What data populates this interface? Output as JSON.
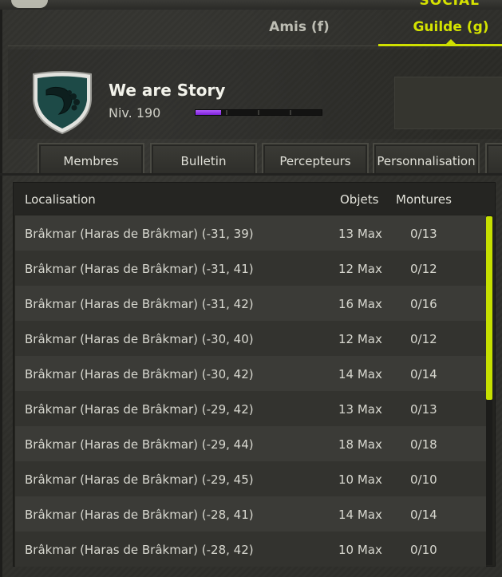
{
  "window": {
    "title": "SOCIAL"
  },
  "tabs": [
    {
      "label": "Amis (f)",
      "active": false
    },
    {
      "label": "Guilde (g)",
      "active": true
    }
  ],
  "guild": {
    "name": "We are Story",
    "level": "Niv. 190",
    "xp_progress": 0.2,
    "emblem_icon": "horn-of-plenty-icon",
    "emblem_color": "#1d4a47"
  },
  "subtabs": [
    "Membres",
    "Bulletin",
    "Percepteurs",
    "Personnalisation"
  ],
  "table": {
    "headers": {
      "location": "Localisation",
      "objects": "Objets",
      "mounts": "Montures"
    },
    "rows": [
      {
        "location": "Brâkmar (Haras de Brâkmar) (-31, 39)",
        "objects": "13 Max",
        "mounts": "0/13"
      },
      {
        "location": "Brâkmar (Haras de Brâkmar) (-31, 41)",
        "objects": "12 Max",
        "mounts": "0/12"
      },
      {
        "location": "Brâkmar (Haras de Brâkmar) (-31, 42)",
        "objects": "16 Max",
        "mounts": "0/16"
      },
      {
        "location": "Brâkmar (Haras de Brâkmar) (-30, 40)",
        "objects": "12 Max",
        "mounts": "0/12"
      },
      {
        "location": "Brâkmar (Haras de Brâkmar) (-30, 42)",
        "objects": "14 Max",
        "mounts": "0/14"
      },
      {
        "location": "Brâkmar (Haras de Brâkmar) (-29, 42)",
        "objects": "13 Max",
        "mounts": "0/13"
      },
      {
        "location": "Brâkmar (Haras de Brâkmar) (-29, 44)",
        "objects": "18 Max",
        "mounts": "0/18"
      },
      {
        "location": "Brâkmar (Haras de Brâkmar) (-29, 45)",
        "objects": "10 Max",
        "mounts": "0/10"
      },
      {
        "location": "Brâkmar (Haras de Brâkmar) (-28, 41)",
        "objects": "14 Max",
        "mounts": "0/14"
      },
      {
        "location": "Brâkmar (Haras de Brâkmar) (-28, 42)",
        "objects": "10 Max",
        "mounts": "0/10"
      }
    ]
  },
  "colors": {
    "accent": "#d4e300",
    "xp": "#9b3cf2"
  }
}
